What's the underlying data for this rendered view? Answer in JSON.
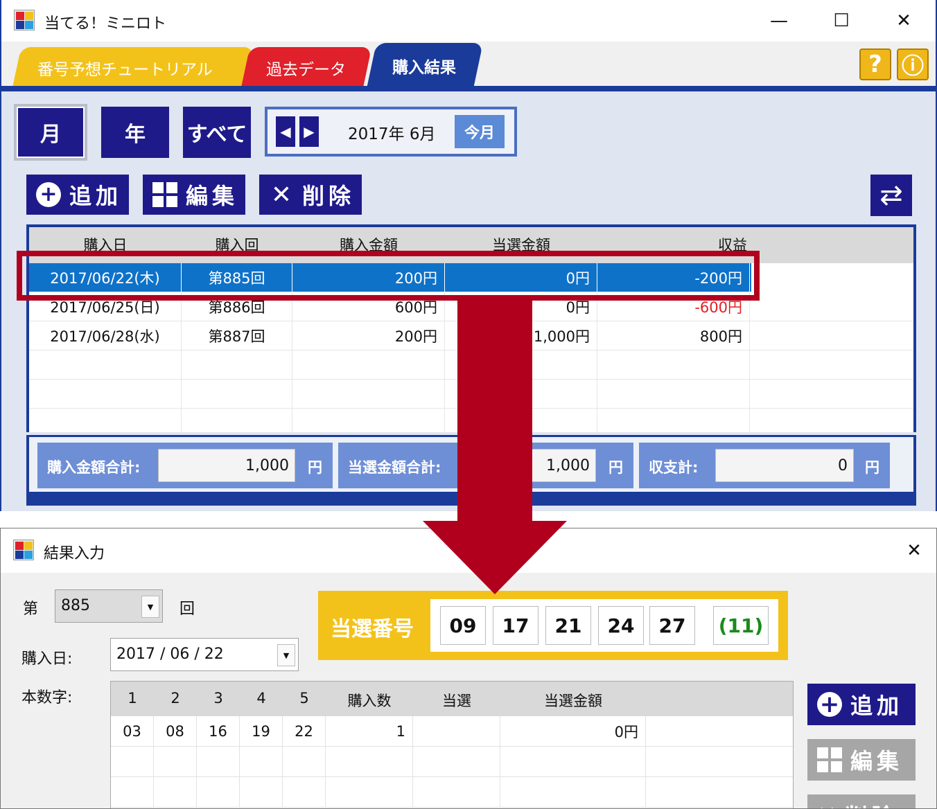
{
  "main_window": {
    "title": "当てる！ミニロト",
    "tabs": [
      {
        "label": "番号予想チュートリアル",
        "color": "#f3c21a"
      },
      {
        "label": "過去データ",
        "color": "#e0202a"
      },
      {
        "label": "購入結果",
        "color": "#1b3b9a",
        "active": true
      }
    ],
    "help_label": "?",
    "info_label": "ⓘ",
    "period_buttons": [
      "月",
      "年",
      "すべて"
    ],
    "active_period": "月",
    "month_label": "2017年 6月",
    "today_label": "今月",
    "actions": {
      "add": "追加",
      "edit": "編集",
      "delete": "削除"
    },
    "table": {
      "headers": [
        "購入日",
        "購入回",
        "購入金額",
        "当選金額",
        "収益"
      ],
      "rows": [
        {
          "date": "2017/06/22(木)",
          "round": "第885回",
          "purchase": "200円",
          "winning": "0円",
          "profit": "-200円",
          "selected": true
        },
        {
          "date": "2017/06/25(日)",
          "round": "第886回",
          "purchase": "600円",
          "winning": "0円",
          "profit": "-600円"
        },
        {
          "date": "2017/06/28(水)",
          "round": "第887回",
          "purchase": "200円",
          "winning": "1,000円",
          "profit": "800円"
        }
      ]
    },
    "summary": {
      "purchase_total_label": "購入金額合計:",
      "purchase_total": "1,000",
      "winning_total_label": "当選金額合計:",
      "winning_total": "1,000",
      "balance_label": "収支計:",
      "balance": "0",
      "unit": "円"
    },
    "splitter_glyph": "▲ ···"
  },
  "dialog": {
    "title": "結果入力",
    "round_prefix": "第",
    "round_value": "885",
    "round_suffix": "回",
    "date_label": "購入日:",
    "date_value": "2017 / 06 / 22",
    "numbers_label": "本数字:",
    "winning_numbers_label": "当選番号",
    "winning_numbers": [
      "09",
      "17",
      "21",
      "24",
      "27"
    ],
    "bonus_number": "(11)",
    "grid_headers": [
      "1",
      "2",
      "3",
      "4",
      "5",
      "購入数",
      "当選",
      "当選金額"
    ],
    "grid_rows": [
      {
        "n1": "03",
        "n2": "08",
        "n3": "16",
        "n4": "19",
        "n5": "22",
        "count": "1",
        "hit": "",
        "amount": "0円"
      }
    ],
    "buttons": {
      "add": "追加",
      "edit": "編集",
      "delete": "削除"
    }
  },
  "colors": {
    "navy": "#1f1a8a",
    "blue": "#1b3b9a",
    "highlight": "#b0001e",
    "gold": "#f3c21a"
  }
}
